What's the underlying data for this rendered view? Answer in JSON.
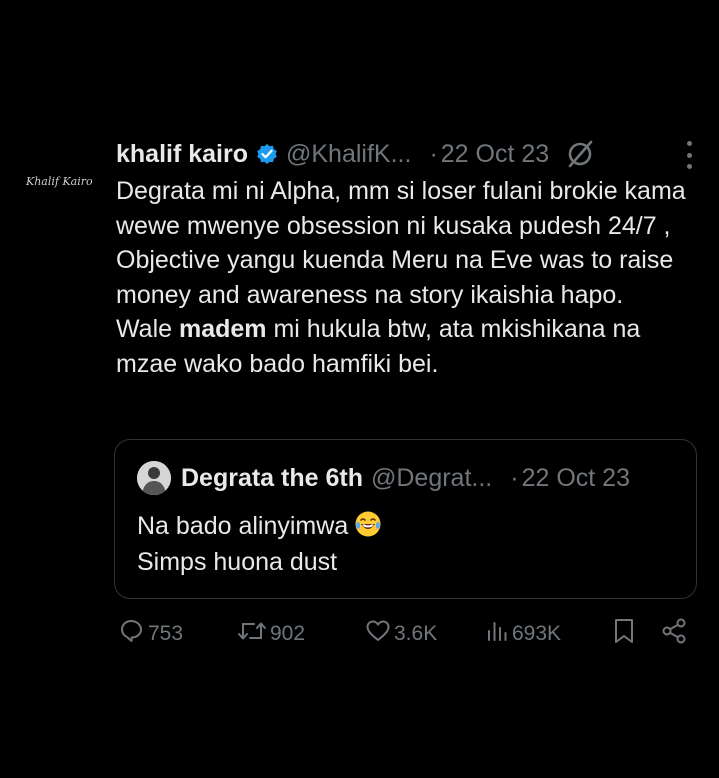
{
  "tweet": {
    "avatar_signature": "Khalif Kairo",
    "name": "khalif kairo",
    "handle": "@KhalifK...",
    "separator": "·",
    "date": "22 Oct 23",
    "text_part1": "Degrata mi ni Alpha, mm  si loser fulani brokie kama wewe mwenye obsession ni kusaka pudesh 24/7 , Objective yangu kuenda Meru na Eve was to raise money and awareness na story ikaishia hapo.",
    "text_part2_prefix": "Wale ",
    "text_part2_bold": "madem",
    "text_part2_suffix": " mi hukula btw, ata mkishikana na mzae wako bado hamfiki bei."
  },
  "quote": {
    "name": "Degrata the 6th",
    "handle": "@Degrat...",
    "separator": "·",
    "date": "22 Oct 23",
    "line1": "Na bado alinyimwa",
    "line2": "Simps huona dust"
  },
  "actions": {
    "replies": "753",
    "retweets": "902",
    "likes": "3.6K",
    "views": "693K"
  },
  "colors": {
    "background": "#000000",
    "text": "#e7e9ea",
    "muted": "#71767b",
    "verified": "#1d9bf0"
  }
}
